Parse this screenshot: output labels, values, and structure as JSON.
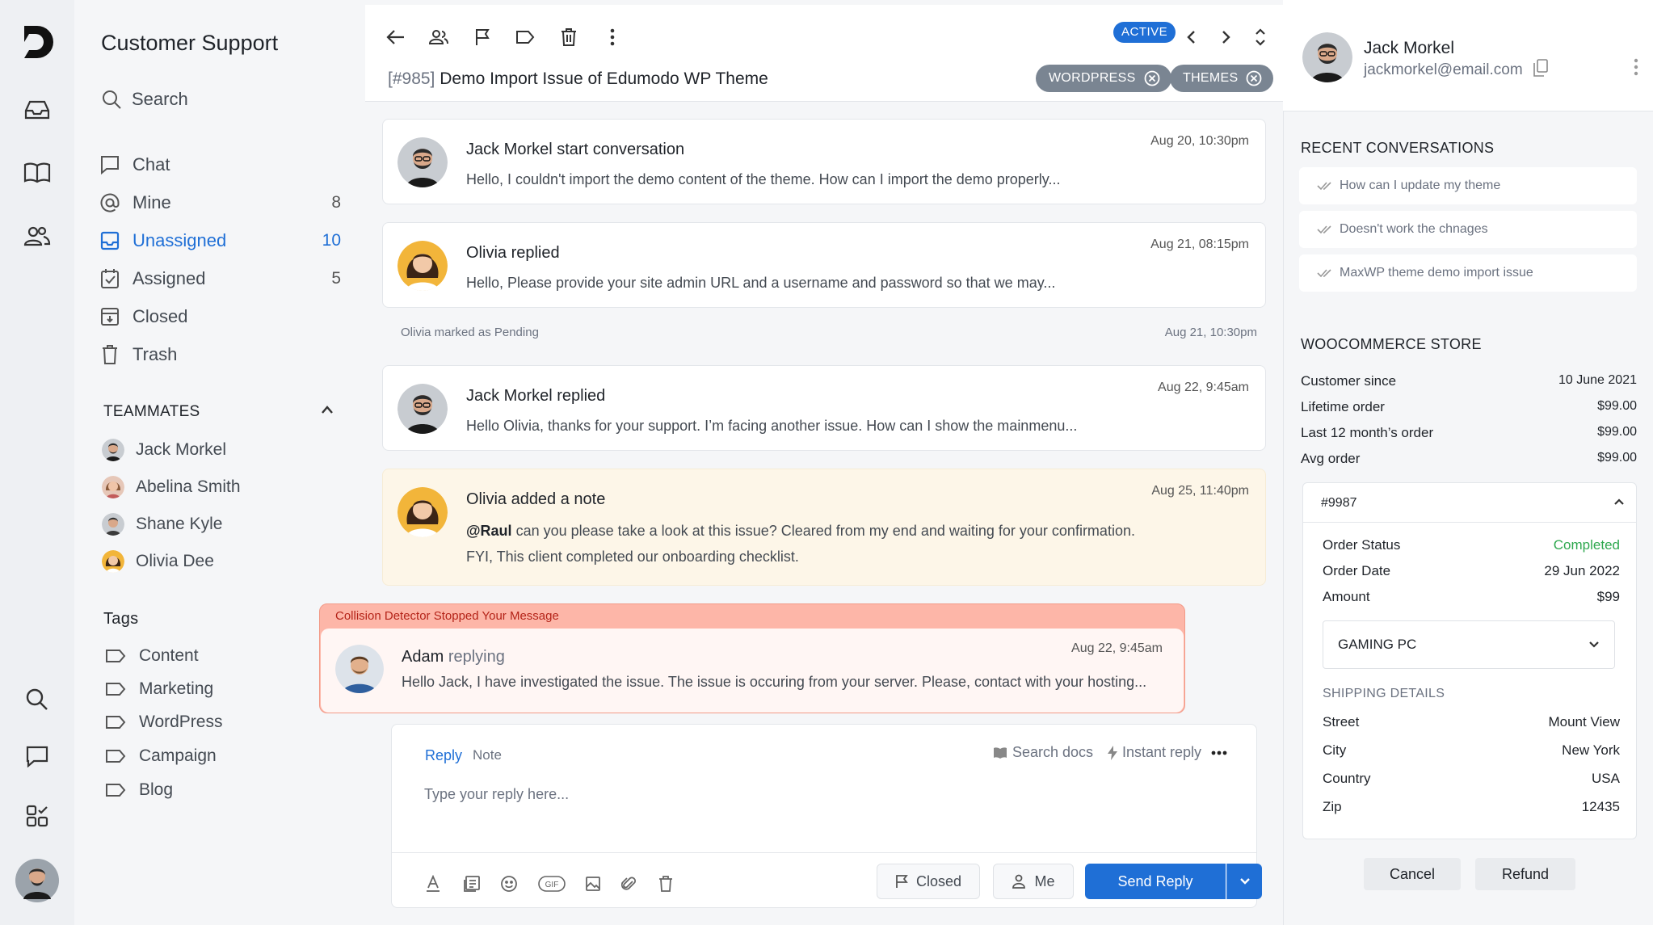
{
  "sidebar": {
    "title": "Customer Support",
    "search_label": "Search",
    "nav": [
      {
        "label": "Chat",
        "count": ""
      },
      {
        "label": "Mine",
        "count": "8"
      },
      {
        "label": "Unassigned",
        "count": "10"
      },
      {
        "label": "Assigned",
        "count": "5"
      },
      {
        "label": "Closed",
        "count": ""
      },
      {
        "label": "Trash",
        "count": ""
      }
    ],
    "teammates_heading": "TEAMMATES",
    "teammates": [
      "Jack Morkel",
      "Abelina Smith",
      "Shane Kyle",
      "Olivia Dee"
    ],
    "tags_heading": "Tags",
    "tags": [
      "Content",
      "Marketing",
      "WordPress",
      "Campaign",
      "Blog"
    ]
  },
  "conversation": {
    "status": "ACTIVE",
    "number": "[#985]",
    "title": "Demo Import Issue of Edumodo WP Theme",
    "chips": [
      "WORDPRESS",
      "THEMES"
    ],
    "messages": [
      {
        "who": "Jack Morkel start conversation",
        "time": "Aug 20, 10:30pm",
        "body": "Hello, I couldn't import the demo content of the theme. How can I import the demo properly..."
      },
      {
        "who": "Olivia replied",
        "time": "Aug 21, 08:15pm",
        "body": "Hello, Please provide your site admin URL and a username and password so that we may..."
      },
      {
        "who": "Jack Morkel replied",
        "time": "Aug 22, 9:45am",
        "body": "Hello Olivia, thanks for your support. I’m facing another issue. How can I show the mainmenu..."
      },
      {
        "who": "Olivia added a note",
        "time": "Aug 25, 11:40pm",
        "mention": "@Raul",
        "body": " can you please take a look at this issue? Cleared from my end and waiting for your confirmation.",
        "body2": "FYI, This client completed our onboarding checklist."
      }
    ],
    "system_event": {
      "text": "Olivia marked as Pending",
      "time": "Aug 21, 10:30pm"
    },
    "collision": {
      "label": "Collision Detector Stopped Your Message",
      "who": "Adam",
      "status": "replying",
      "time": "Aug 22, 9:45am",
      "body": "Hello Jack, I have investigated the issue. The issue is occuring from your server. Please, contact with your hosting..."
    },
    "reply": {
      "tab_reply": "Reply",
      "tab_note": "Note",
      "search_docs": "Search docs",
      "instant_reply": "Instant reply",
      "placeholder": "Type your reply here...",
      "status_button": "Closed",
      "assignee_button": "Me",
      "send_label": "Send Reply"
    }
  },
  "customer": {
    "name": "Jack Morkel",
    "email": "jackmorkel@email.com",
    "recent_heading": "RECENT CONVERSATIONS",
    "recent": [
      "How can I update my theme",
      "Doesn't work the chnages",
      "MaxWP theme demo import issue"
    ],
    "store_heading": "WOOCOMMERCE STORE",
    "store": [
      {
        "k": "Customer since",
        "v": "10 June 2021"
      },
      {
        "k": "Lifetime order",
        "v": "$99.00"
      },
      {
        "k": "Last 12 month’s order",
        "v": "$99.00"
      },
      {
        "k": "Avg order",
        "v": "$99.00"
      }
    ],
    "order": {
      "id": "#9987",
      "status_label": "Order Status",
      "status": "Completed",
      "date_label": "Order Date",
      "date": "29 Jun 2022",
      "amount_label": "Amount",
      "amount": "$99",
      "product": "GAMING PC",
      "shipping_heading": "SHIPPING DETAILS",
      "shipping": [
        {
          "k": "Street",
          "v": "Mount View"
        },
        {
          "k": "City",
          "v": "New York"
        },
        {
          "k": "Country",
          "v": "USA"
        },
        {
          "k": "Zip",
          "v": "12435"
        }
      ]
    },
    "cancel_label": "Cancel",
    "refund_label": "Refund"
  },
  "colors": {
    "accent": "#1f6fd6",
    "success": "#2fa84f",
    "collision": "#fdb6a8"
  }
}
